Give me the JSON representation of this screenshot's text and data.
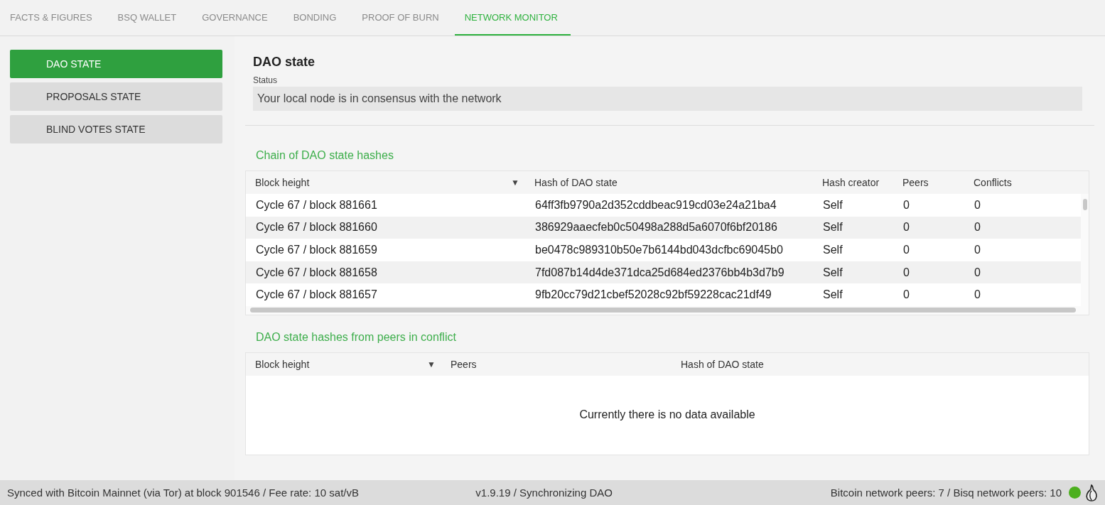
{
  "tabs": [
    {
      "label": "FACTS & FIGURES",
      "selected": false
    },
    {
      "label": "BSQ WALLET",
      "selected": false
    },
    {
      "label": "GOVERNANCE",
      "selected": false
    },
    {
      "label": "BONDING",
      "selected": false
    },
    {
      "label": "PROOF OF BURN",
      "selected": false
    },
    {
      "label": "NETWORK MONITOR",
      "selected": true
    }
  ],
  "sidebar": {
    "items": [
      {
        "label": "DAO STATE",
        "selected": true
      },
      {
        "label": "PROPOSALS STATE",
        "selected": false
      },
      {
        "label": "BLIND VOTES STATE",
        "selected": false
      }
    ]
  },
  "header": {
    "title": "DAO state",
    "status_label": "Status",
    "status_value": "Your local node is in consensus with the network"
  },
  "chain_table": {
    "title": "Chain of DAO state hashes",
    "sort_indicator": "▼",
    "columns": [
      "Block height",
      "Hash of DAO state",
      "Hash creator",
      "Peers",
      "Conflicts"
    ],
    "rows": [
      [
        "Cycle 67 / block 881661",
        "64ff3fb9790a2d352cddbeac919cd03e24a21ba4",
        "Self",
        "0",
        "0"
      ],
      [
        "Cycle 67 / block 881660",
        "386929aaecfeb0c50498a288d5a6070f6bf20186",
        "Self",
        "0",
        "0"
      ],
      [
        "Cycle 67 / block 881659",
        "be0478c989310b50e7b6144bd043dcfbc69045b0",
        "Self",
        "0",
        "0"
      ],
      [
        "Cycle 67 / block 881658",
        "7fd087b14d4de371dca25d684ed2376bb4b3d7b9",
        "Self",
        "0",
        "0"
      ],
      [
        "Cycle 67 / block 881657",
        "9fb20cc79d21cbef52028c92bf59228cac21df49",
        "Self",
        "0",
        "0"
      ]
    ]
  },
  "conflict_table": {
    "title": "DAO state hashes from peers in conflict",
    "sort_indicator": "▼",
    "columns": [
      "Block height",
      "Peers",
      "Hash of DAO state"
    ],
    "empty_message": "Currently there is no data available"
  },
  "status_bar": {
    "sync": "Synced with Bitcoin Mainnet (via Tor) at block 901546 / Fee rate: 10 sat/vB",
    "version": "v1.9.19 / Synchronizing DAO",
    "peers": "Bitcoin network peers: 7 / Bisq network peers: 10",
    "online": true
  }
}
